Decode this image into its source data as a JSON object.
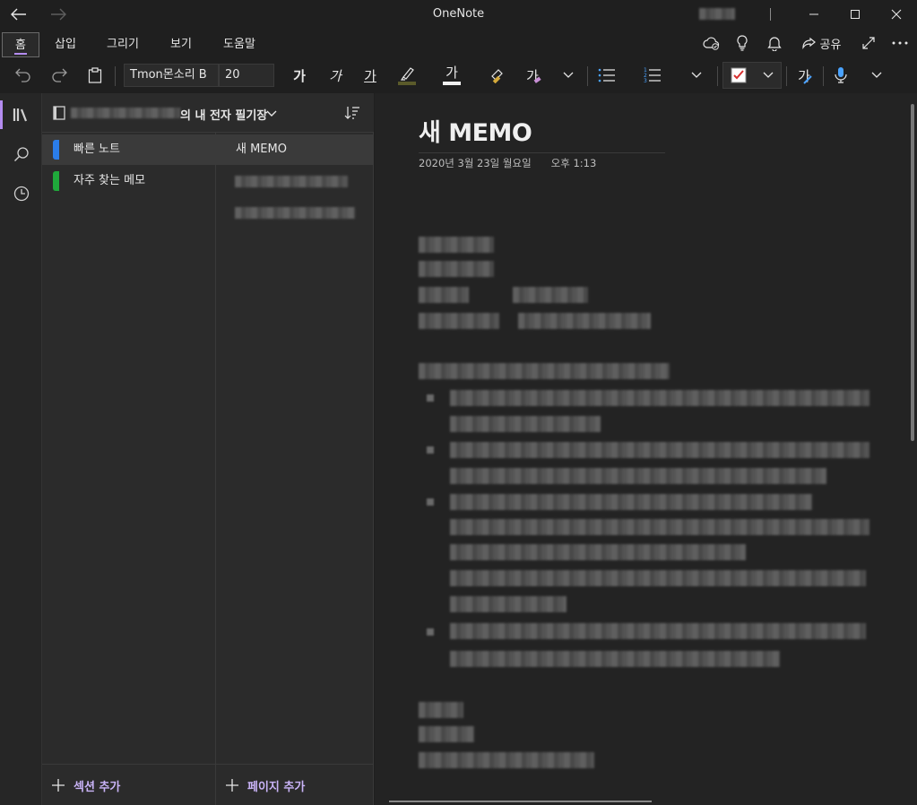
{
  "window": {
    "title": "OneNote"
  },
  "menu": {
    "tabs": [
      "홈",
      "삽입",
      "그리기",
      "보기",
      "도움말"
    ],
    "active_tab": "홈",
    "share_label": "공유"
  },
  "toolbar": {
    "font_name": "Tmon몬소리 B",
    "font_size": "20",
    "bold_glyph": "가",
    "italic_glyph": "가",
    "underline_glyph": "가",
    "fontcolor_glyph": "가",
    "clear_glyph": "가",
    "spell_glyph": "가"
  },
  "notebook": {
    "title_suffix": "의 내 전자 필기장"
  },
  "sections": {
    "items": [
      {
        "label": "빠른 노트",
        "color": "#2b7de9"
      },
      {
        "label": "자주 찾는 메모",
        "color": "#1fa93b"
      }
    ],
    "add_label": "섹션 추가"
  },
  "pages": {
    "items": [
      "새 MEMO"
    ],
    "add_label": "페이지 추가"
  },
  "note": {
    "title": "새 MEMO",
    "date": "2020년 3월 23일 월요일",
    "time": "오후 1:13"
  },
  "colors": {
    "accent": "#b48cf0",
    "background": "#1f1f1f",
    "pane": "#2b2b2b",
    "canvas": "#232323"
  },
  "icons": [
    "back-arrow-icon",
    "forward-arrow-icon",
    "minimize-icon",
    "maximize-icon",
    "close-icon",
    "sync-cloud-icon",
    "lightbulb-icon",
    "bell-icon",
    "share-icon",
    "fullscreen-icon",
    "more-icon",
    "undo-icon",
    "redo-icon",
    "clipboard-icon",
    "highlighter-icon",
    "format-painter-icon",
    "bullet-list-icon",
    "numbered-list-icon",
    "todo-checkbox-icon",
    "dictate-mic-icon",
    "notebooks-icon",
    "search-icon",
    "recent-clock-icon",
    "notebook-icon",
    "sort-icon",
    "plus-icon"
  ]
}
